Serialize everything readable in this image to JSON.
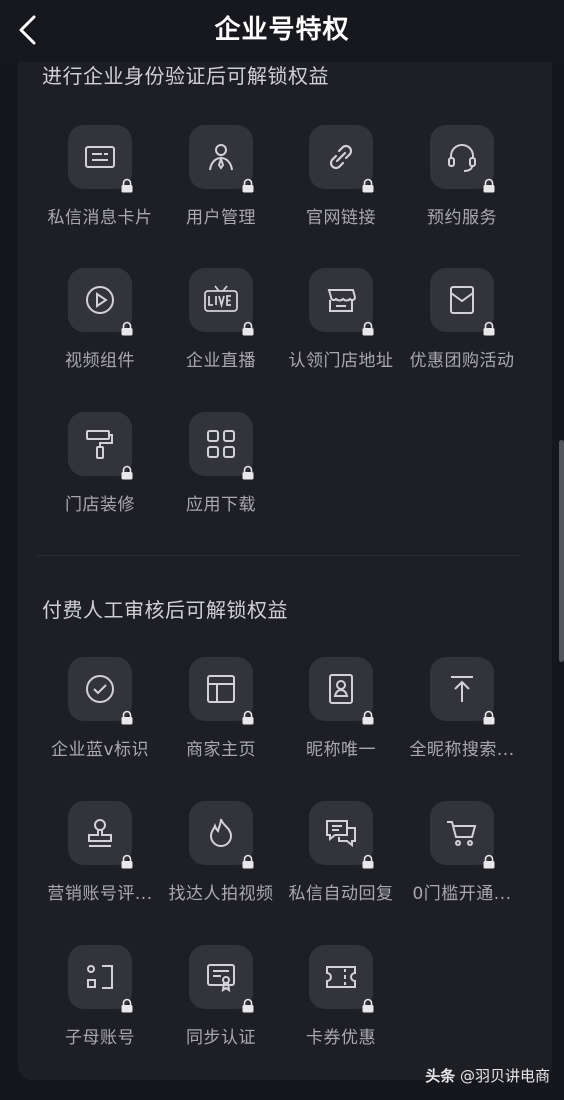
{
  "header": {
    "title": "企业号特权"
  },
  "section1": {
    "title": "进行企业身份验证后可解锁权益",
    "items": [
      {
        "label": "私信消息卡片",
        "icon": "message-card-icon"
      },
      {
        "label": "用户管理",
        "icon": "user-management-icon"
      },
      {
        "label": "官网链接",
        "icon": "link-icon"
      },
      {
        "label": "预约服务",
        "icon": "headset-icon"
      },
      {
        "label": "视频组件",
        "icon": "play-icon"
      },
      {
        "label": "企业直播",
        "icon": "live-tv-icon"
      },
      {
        "label": "认领门店地址",
        "icon": "storefront-icon"
      },
      {
        "label": "优惠团购活动",
        "icon": "coupon-envelope-icon"
      },
      {
        "label": "门店装修",
        "icon": "paint-roller-icon"
      },
      {
        "label": "应用下载",
        "icon": "app-grid-icon"
      }
    ]
  },
  "section2": {
    "title": "付费人工审核后可解锁权益",
    "items": [
      {
        "label": "企业蓝v标识",
        "icon": "check-circle-icon"
      },
      {
        "label": "商家主页",
        "icon": "layout-icon"
      },
      {
        "label": "昵称唯一",
        "icon": "id-badge-icon"
      },
      {
        "label": "全昵称搜索...",
        "icon": "upload-top-icon"
      },
      {
        "label": "营销账号评...",
        "icon": "stamp-icon"
      },
      {
        "label": "找达人拍视频",
        "icon": "flame-icon"
      },
      {
        "label": "私信自动回复",
        "icon": "chat-reply-icon"
      },
      {
        "label": "0门槛开通...",
        "icon": "cart-icon"
      },
      {
        "label": "子母账号",
        "icon": "sub-account-icon"
      },
      {
        "label": "同步认证",
        "icon": "certificate-icon"
      },
      {
        "label": "卡券优惠",
        "icon": "ticket-icon"
      }
    ]
  },
  "watermark": {
    "brand": "头条",
    "author": "@羽贝讲电商"
  }
}
